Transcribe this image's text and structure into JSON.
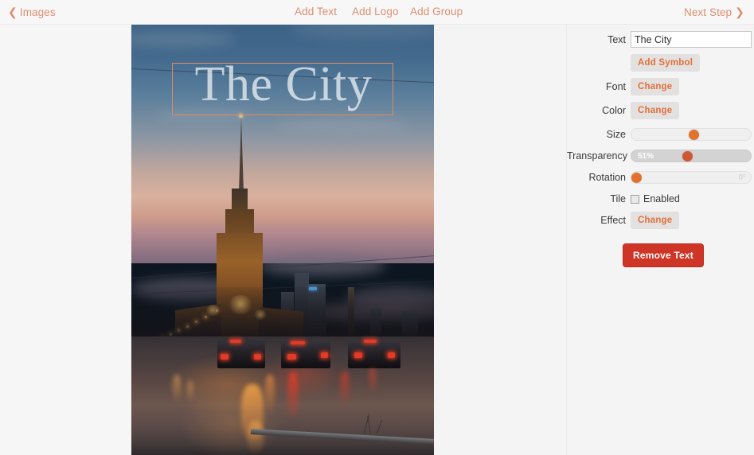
{
  "topnav": {
    "back_label": "Images",
    "back_chevron": "chevron-left-icon",
    "links": [
      {
        "label": "Add Text"
      },
      {
        "label": "Add Logo"
      },
      {
        "label": "Add Group"
      }
    ],
    "next_label": "Next Step",
    "next_chevron": "chevron-right-icon"
  },
  "canvas": {
    "overlay_text": "The City",
    "photo_description": "Moscow skyline at dusk with Hotel Ukraina tower and cars on wet road"
  },
  "sidebar": {
    "text": {
      "label": "Text",
      "value": "The City",
      "placeholder": ""
    },
    "add_symbol": {
      "label": "Add Symbol"
    },
    "font": {
      "label": "Font",
      "button": "Change"
    },
    "color": {
      "label": "Color",
      "button": "Change"
    },
    "size": {
      "label": "Size",
      "value": "",
      "percent": 55
    },
    "transparency": {
      "label": "Transparency",
      "value": "51%",
      "percent": 51
    },
    "rotation": {
      "label": "Rotation",
      "value": "0°",
      "percent": 0
    },
    "tile": {
      "label": "Tile",
      "checkbox_label": "Enabled",
      "checked": false
    },
    "effect": {
      "label": "Effect",
      "button": "Change"
    },
    "remove": {
      "label": "Remove Text"
    }
  },
  "colors": {
    "accent_orange": "#e2703a",
    "nav_link": "#dd8e6f",
    "danger_red": "#cf3526",
    "slider_handle": "#e2712f",
    "selection_border": "#e08b62",
    "page_bg": "#f4f4f4"
  }
}
